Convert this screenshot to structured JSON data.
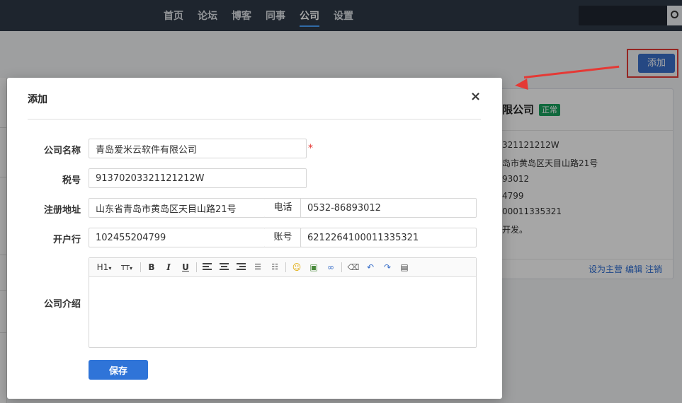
{
  "nav": {
    "items": [
      "首页",
      "论坛",
      "博客",
      "同事",
      "公司",
      "设置"
    ],
    "active": "公司"
  },
  "page": {
    "add_button_label": "添加"
  },
  "card": {
    "title": "限公司",
    "status": "正常",
    "lines": [
      "321121212W",
      "岛市黄岛区天目山路21号",
      "93012",
      "4799",
      "00011335321",
      "开发。"
    ],
    "actions": [
      "设为主营",
      "编辑",
      "注销"
    ]
  },
  "modal": {
    "title": "添加",
    "close_glyph": "×",
    "fields": {
      "company_name_label": "公司名称",
      "company_name_value": "青岛爱米云软件有限公司",
      "tax_label": "税号",
      "tax_value": "91370203321121212W",
      "address_label": "注册地址",
      "address_value": "山东省青岛市黄岛区天目山路21号",
      "phone_label": "电话",
      "phone_value": "0532-86893012",
      "bank_label": "开户行",
      "bank_value": "102455204799",
      "account_label": "账号",
      "account_value": "6212264100011335321",
      "intro_label": "公司介绍"
    },
    "toolbar": {
      "heading": "H1",
      "font_size": "TT",
      "bold": "B",
      "italic": "I",
      "underline": "U"
    },
    "save_label": "保存"
  },
  "colors": {
    "accent": "#2f74d8",
    "annotation": "#e53935",
    "badge": "#19a15f",
    "navbar": "#2f3947"
  }
}
